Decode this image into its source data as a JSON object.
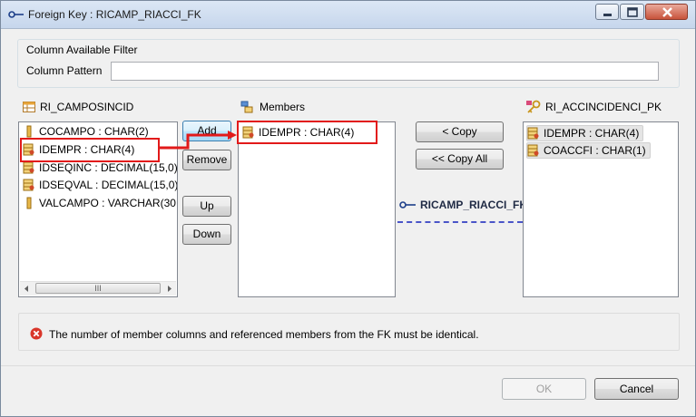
{
  "window": {
    "title": "Foreign Key : RICAMP_RIACCI_FK",
    "icon": "key-connector-icon"
  },
  "filter": {
    "group_label": "Column Available Filter",
    "pattern_label": "Column Pattern",
    "pattern_value": ""
  },
  "source_table": {
    "name": "RI_CAMPOSINCID",
    "icon": "table-icon",
    "columns": [
      {
        "label": "COCAMPO : CHAR(2)",
        "icon": "column-icon"
      },
      {
        "label": "IDEMPR : CHAR(4)",
        "icon": "pk-column-icon"
      },
      {
        "label": "IDSEQINC : DECIMAL(15,0)",
        "icon": "pk-column-icon"
      },
      {
        "label": "IDSEQVAL : DECIMAL(15,0)",
        "icon": "pk-column-icon"
      },
      {
        "label": "VALCAMPO : VARCHAR(30",
        "icon": "column-icon"
      }
    ],
    "scrollbar_grip": "III"
  },
  "actions": {
    "add": "Add",
    "remove": "Remove",
    "up": "Up",
    "down": "Down"
  },
  "members": {
    "label": "Members",
    "icon": "members-icon",
    "items": [
      {
        "label": "IDEMPR : CHAR(4)",
        "icon": "pk-column-icon"
      }
    ]
  },
  "copy": {
    "copy": "< Copy",
    "copy_all": "<< Copy All"
  },
  "relation": {
    "name": "RICAMP_RIACCI_FK",
    "icon": "key-connector-icon",
    "line_color": "#4a55c8"
  },
  "target_table": {
    "name": "RI_ACCINCIDENCI_PK",
    "icon": "primary-key-icon",
    "items": [
      {
        "label": "IDEMPR : CHAR(4)",
        "icon": "pk-column-icon"
      },
      {
        "label": "COACCFI : CHAR(1)",
        "icon": "pk-column-icon"
      }
    ]
  },
  "message": {
    "icon": "error-icon",
    "text": "The number of member columns and referenced members from the FK must be identical."
  },
  "footer": {
    "ok": "OK",
    "cancel": "Cancel"
  },
  "colors": {
    "highlight": "#e21a1a",
    "error": "#d9362a"
  }
}
